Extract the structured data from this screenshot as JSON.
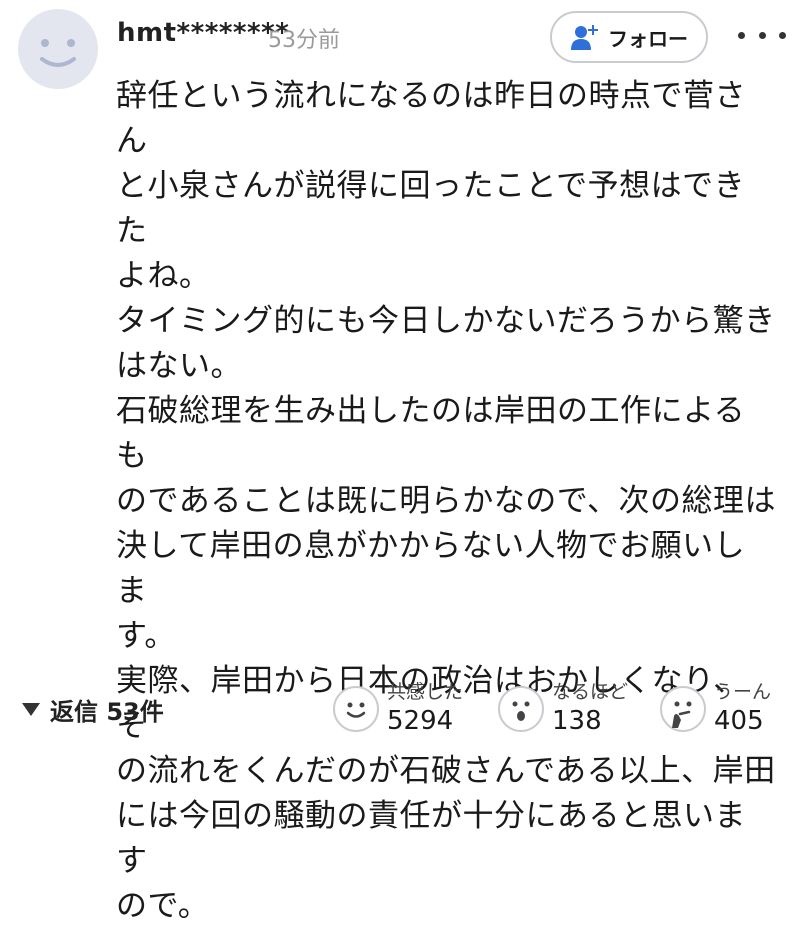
{
  "user": {
    "name": "hmt********",
    "time": "53分前",
    "avatar_icon": "smiley-avatar-icon"
  },
  "actions": {
    "follow_label": "フォロー",
    "follow_icon": "person-plus-icon",
    "more_icon": "more-dots-icon"
  },
  "comment": {
    "text": "辞任という流れになるのは昨日の時点で菅さん\nと小泉さんが説得に回ったことで予想はできた\nよね。\nタイミング的にも今日しかないだろうから驚き\nはない。\n石破総理を生み出したのは岸田の工作によるも\nのであることは既に明らかなので、次の総理は\n決して岸田の息がかからない人物でお願いしま\nす。\n実際、岸田から日本の政治はおかしくなり、そ\nの流れをくんだのが石破さんである以上、岸田\nには今回の騒動の責任が十分にあると思います\nので。"
  },
  "replies": {
    "label": "返信 53件",
    "icon": "caret-down-icon"
  },
  "reactions": [
    {
      "label": "共感した",
      "count": "5294",
      "icon": "smile-face-icon"
    },
    {
      "label": "なるほど",
      "count": "138",
      "icon": "surprised-face-icon"
    },
    {
      "label": "うーん",
      "count": "405",
      "icon": "thinking-face-icon"
    }
  ],
  "colors": {
    "accent": "#2f6fda",
    "avatar_bg": "#e3e6ef",
    "avatar_fg": "#aeb6d0"
  }
}
